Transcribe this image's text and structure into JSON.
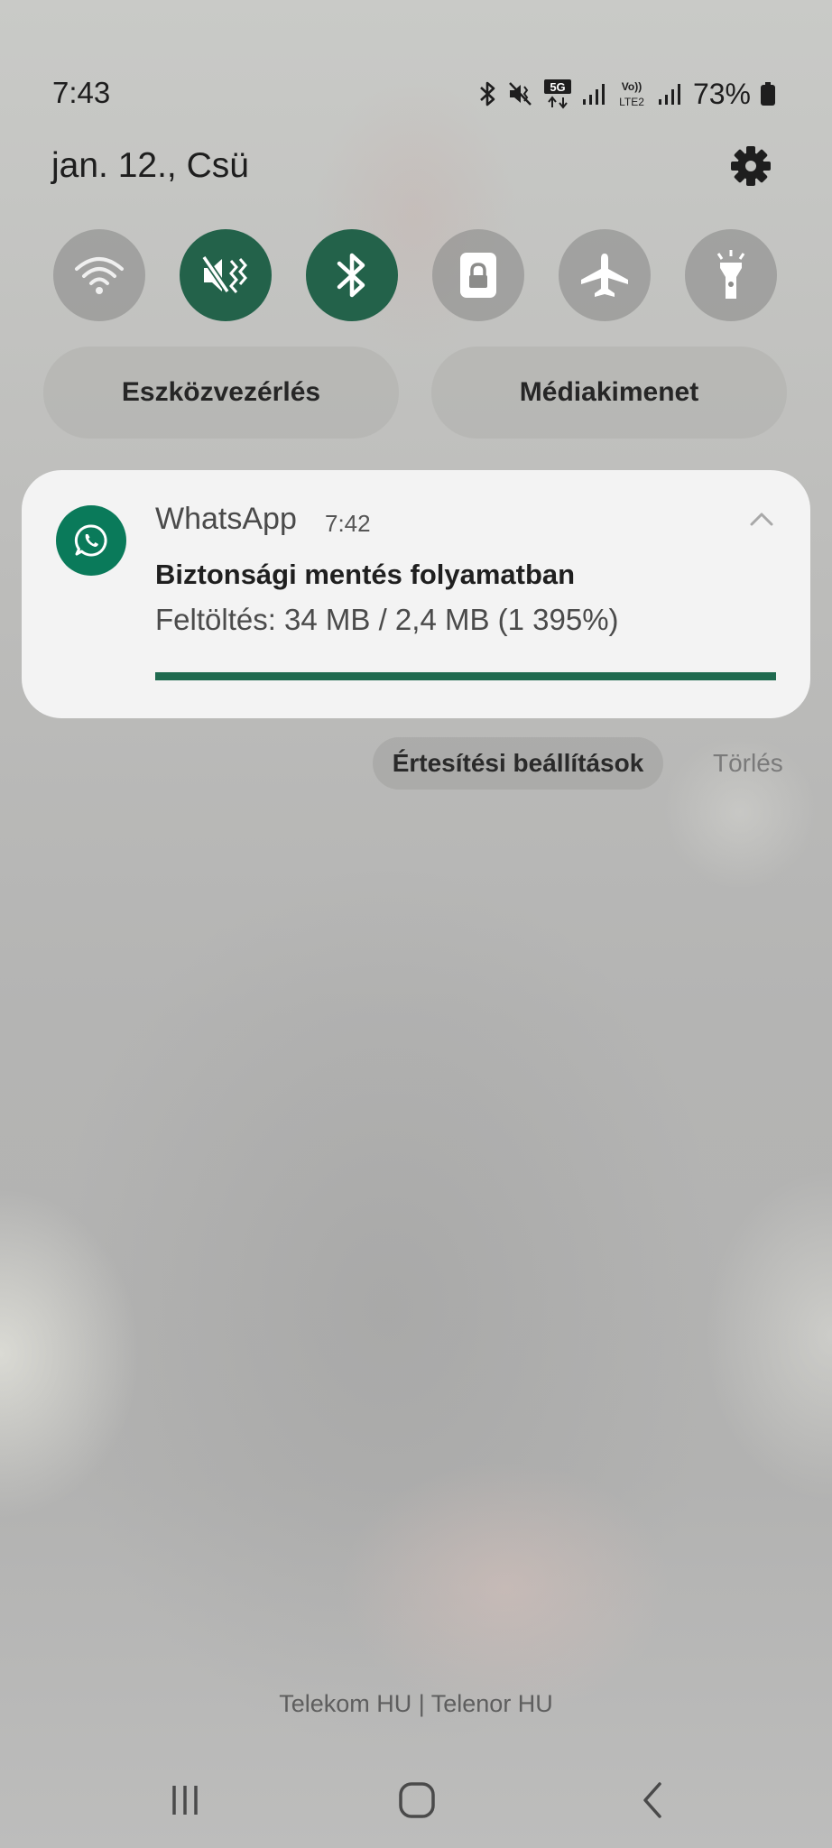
{
  "status_bar": {
    "time": "7:43",
    "network_badge": "5G",
    "volte_label": "Vo)) LTE2",
    "battery_percent": "73%",
    "icons": [
      "bluetooth-icon",
      "mute-vibrate-icon",
      "5g-icon",
      "signal-icon",
      "volte-lte2-icon",
      "signal-icon",
      "battery-icon"
    ]
  },
  "header": {
    "date": "jan. 12., Csü",
    "settings_icon": "gear-icon"
  },
  "quick_settings": [
    {
      "name": "wifi",
      "icon": "wifi-icon",
      "active": false
    },
    {
      "name": "sound",
      "icon": "mute-vibrate-icon",
      "active": true
    },
    {
      "name": "bluetooth",
      "icon": "bluetooth-icon",
      "active": true
    },
    {
      "name": "rotation-lock",
      "icon": "lock-icon",
      "active": false
    },
    {
      "name": "airplane",
      "icon": "airplane-icon",
      "active": false
    },
    {
      "name": "flashlight",
      "icon": "flashlight-icon",
      "active": false
    }
  ],
  "pills": {
    "device_control": "Eszközvezérlés",
    "media_output": "Médiakimenet"
  },
  "notification": {
    "app_name": "WhatsApp",
    "time": "7:42",
    "title": "Biztonsági mentés folyamatban",
    "body": "Feltöltés: 34 MB / 2,4 MB (1 395%)",
    "progress": 1.0,
    "accent_color": "#1f6a4f"
  },
  "actions": {
    "notification_settings": "Értesítési beállítások",
    "clear": "Törlés"
  },
  "carrier": "Telekom HU | Telenor HU",
  "nav": [
    "recents-icon",
    "home-icon",
    "back-icon"
  ]
}
